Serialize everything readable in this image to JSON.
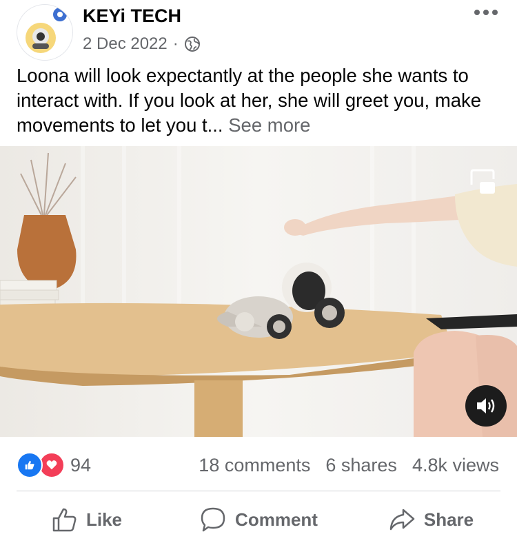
{
  "post": {
    "page_name": "KEYi TECH",
    "date": "2 Dec 2022",
    "separator": "·",
    "audience_icon": "globe-icon",
    "text": "Loona will look expectantly at the people she wants to interact with. If you look at her, she will greet you, make movements to let you t...",
    "see_more": "See more"
  },
  "video": {
    "pip_icon": "picture-in-picture-icon",
    "sound_icon": "volume-icon"
  },
  "stats": {
    "reactions": [
      "like",
      "love"
    ],
    "reaction_count": "94",
    "comments": "18 comments",
    "shares": "6 shares",
    "views": "4.8k views"
  },
  "actions": {
    "like": "Like",
    "comment": "Comment",
    "share": "Share"
  },
  "colors": {
    "like_blue": "#1877f2",
    "love_red": "#f33e58",
    "secondary_text": "#65676b"
  }
}
